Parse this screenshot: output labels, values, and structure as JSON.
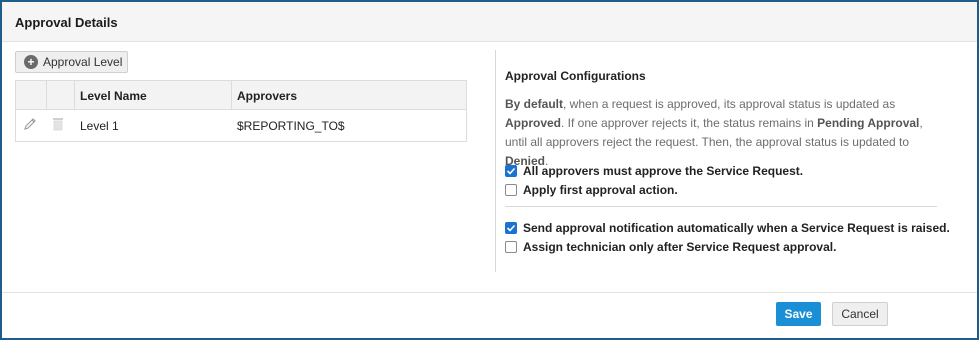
{
  "header": {
    "title": "Approval Details"
  },
  "left": {
    "add_button_label": "Approval Level",
    "table": {
      "columns": [
        "Level Name",
        "Approvers"
      ],
      "rows": [
        {
          "level_name": "Level 1",
          "approvers": "$REPORTING_TO$"
        }
      ]
    }
  },
  "right": {
    "title": "Approval Configurations",
    "description": {
      "p1": "By default",
      "p2": ", when a request is approved, its approval status is updated as ",
      "p3": "Approved",
      "p4": ". If one approver rejects it, the status remains in ",
      "p5": "Pending Approval",
      "p6": ", until all approvers reject the request. Then, the approval status is updated to ",
      "p7": "Denied",
      "p8": "."
    },
    "options": [
      {
        "label": "All approvers must approve the Service Request.",
        "checked": true
      },
      {
        "label": "Apply first approval action.",
        "checked": false
      },
      {
        "label": "Send approval notification automatically when a Service Request is raised.",
        "checked": true
      },
      {
        "label": "Assign technician only after Service Request approval.",
        "checked": false
      }
    ]
  },
  "footer": {
    "save_label": "Save",
    "cancel_label": "Cancel"
  },
  "colors": {
    "accent": "#1a8fd6",
    "checkbox": "#1a73d1",
    "frame": "#1f5c8a"
  }
}
